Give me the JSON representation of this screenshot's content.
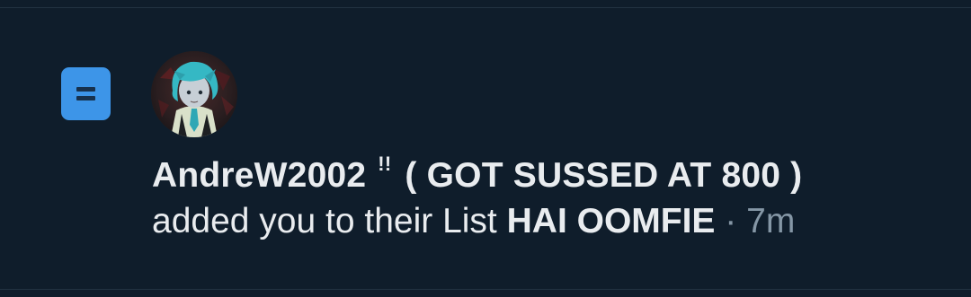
{
  "notification": {
    "user_name": "AndreW2002",
    "name_marks": "!!",
    "name_suffix": "( GOT SUSSED AT 800 )",
    "action_text": "added you to their List",
    "list_name": "HAI OOMFIE",
    "separator": "·",
    "timestamp": "7m",
    "icon": "list-icon",
    "avatar": "user-avatar"
  },
  "colors": {
    "background": "#0f1d2b",
    "accent": "#3d95e8",
    "text": "#e9ecef",
    "muted_text": "#8597a6"
  }
}
